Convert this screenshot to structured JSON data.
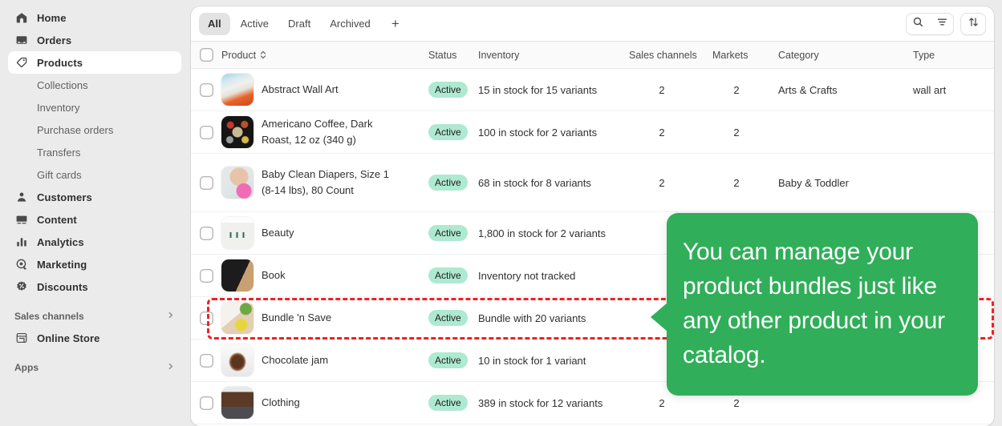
{
  "sidebar": {
    "items": [
      {
        "label": "Home",
        "icon": "home-icon",
        "active": false
      },
      {
        "label": "Orders",
        "icon": "orders-icon",
        "active": false
      },
      {
        "label": "Products",
        "icon": "tag-icon",
        "active": true
      }
    ],
    "sub_items": [
      {
        "label": "Collections"
      },
      {
        "label": "Inventory"
      },
      {
        "label": "Purchase orders"
      },
      {
        "label": "Transfers"
      },
      {
        "label": "Gift cards"
      }
    ],
    "items2": [
      {
        "label": "Customers",
        "icon": "person-icon"
      },
      {
        "label": "Content",
        "icon": "content-icon"
      },
      {
        "label": "Analytics",
        "icon": "bar-chart-icon"
      },
      {
        "label": "Marketing",
        "icon": "marketing-target-icon"
      },
      {
        "label": "Discounts",
        "icon": "discount-badge-icon"
      }
    ],
    "sales_channels": {
      "label": "Sales channels",
      "chevron": "chevron-right-icon",
      "items": [
        {
          "label": "Online Store",
          "icon": "storefront-icon"
        }
      ]
    },
    "apps": {
      "label": "Apps",
      "chevron": "chevron-right-icon"
    }
  },
  "tabs": [
    {
      "label": "All",
      "selected": true
    },
    {
      "label": "Active",
      "selected": false
    },
    {
      "label": "Draft",
      "selected": false
    },
    {
      "label": "Archived",
      "selected": false
    }
  ],
  "tab_add_label": "+",
  "toolbar": {
    "search_icon": "search-icon",
    "filter_icon": "filter-icon",
    "sort_icon": "sort-arrows-icon"
  },
  "table": {
    "headers": {
      "product": "Product",
      "status": "Status",
      "inventory": "Inventory",
      "sales_channels": "Sales channels",
      "markets": "Markets",
      "category": "Category",
      "type": "Type"
    },
    "rows": [
      {
        "name": "Abstract Wall Art",
        "status": "Active",
        "inventory": "15 in stock for 15 variants",
        "sales_channels": "2",
        "markets": "2",
        "category": "Arts & Crafts",
        "type": "wall art"
      },
      {
        "name": "Americano Coffee, Dark Roast, 12 oz (340 g)",
        "status": "Active",
        "inventory": "100 in stock for 2 variants",
        "sales_channels": "2",
        "markets": "2",
        "category": "",
        "type": ""
      },
      {
        "name": "Baby Clean Diapers, Size 1 (8-14 lbs), 80 Count",
        "status": "Active",
        "inventory": "68 in stock for 8 variants",
        "sales_channels": "2",
        "markets": "2",
        "category": "Baby & Toddler",
        "type": ""
      },
      {
        "name": "Beauty",
        "status": "Active",
        "inventory": "1,800 in stock for 2 variants",
        "sales_channels": "",
        "markets": "",
        "category": "",
        "type": ""
      },
      {
        "name": "Book",
        "status": "Active",
        "inventory": "Inventory not tracked",
        "sales_channels": "",
        "markets": "",
        "category": "",
        "type": ""
      },
      {
        "name": "Bundle 'n Save",
        "status": "Active",
        "inventory": "Bundle with 20 variants",
        "sales_channels": "",
        "markets": "",
        "category": "",
        "type": ""
      },
      {
        "name": "Chocolate jam",
        "status": "Active",
        "inventory": "10 in stock for 1 variant",
        "sales_channels": "",
        "markets": "",
        "category": "",
        "type": ""
      },
      {
        "name": "Clothing",
        "status": "Active",
        "inventory": "389 in stock for 12 variants",
        "sales_channels": "2",
        "markets": "2",
        "category": "",
        "type": ""
      }
    ]
  },
  "callout": {
    "text": "You can manage your product bundles just like any other product in your catalog.",
    "color": "#30ae59"
  },
  "highlight": {
    "color": "#ee2222"
  }
}
